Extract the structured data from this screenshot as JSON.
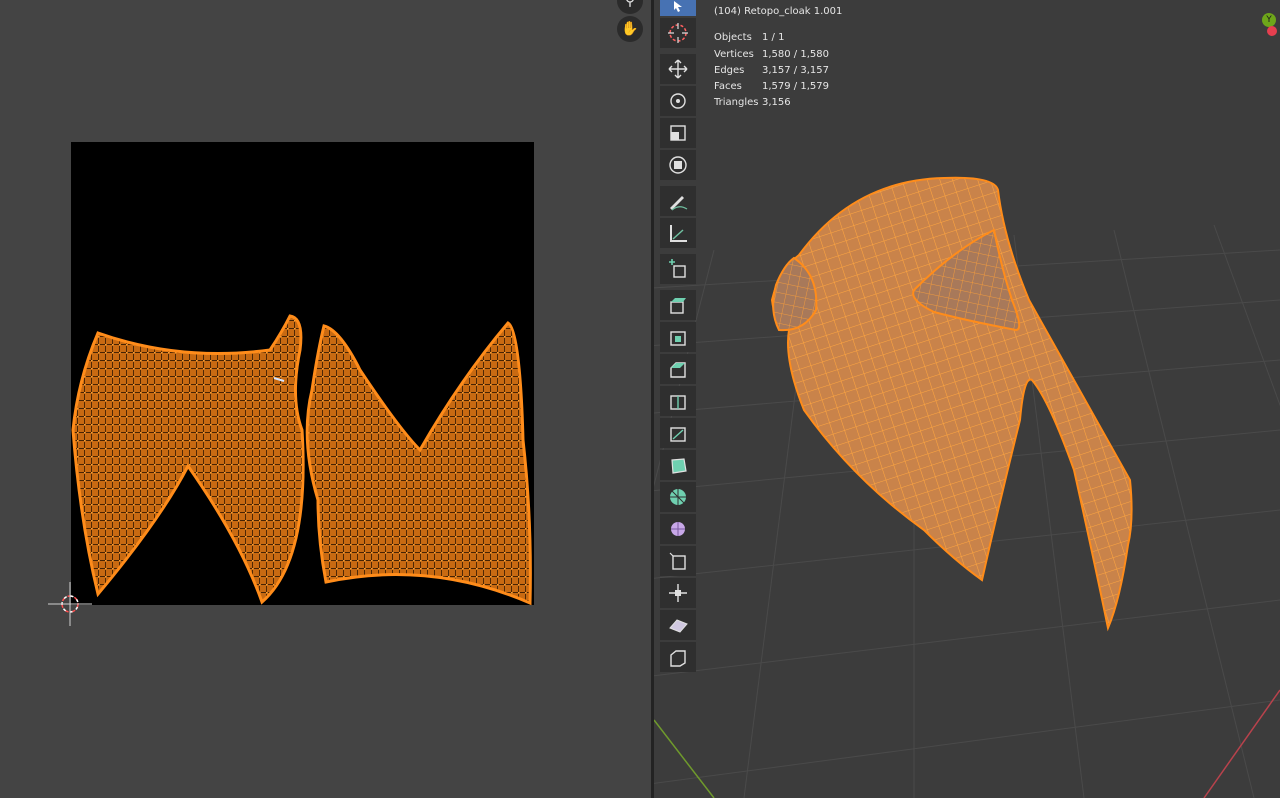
{
  "uv_editor": {
    "gizmo": {
      "zoom_icon": "magnifier-icon",
      "pan_icon": "hand-icon"
    },
    "accent_color": "#ff8c1a"
  },
  "viewport": {
    "object_name": "(104) Retopo_cloak 1.001",
    "stats": [
      {
        "label": "Objects",
        "value": "1 / 1"
      },
      {
        "label": "Vertices",
        "value": "1,580 / 1,580"
      },
      {
        "label": "Edges",
        "value": "3,157 / 3,157"
      },
      {
        "label": "Faces",
        "value": "1,579 / 1,579"
      },
      {
        "label": "Triangles",
        "value": "3,156"
      }
    ],
    "axis_gizmo": {
      "y_label": "Y",
      "y_color": "#6ea61a",
      "x_color": "#e63f4f"
    },
    "mesh_color": "#ff8c1a"
  },
  "toolbar": {
    "tools": [
      {
        "name": "select-box",
        "icon": "cursor-icon",
        "active": true
      },
      {
        "name": "cursor",
        "icon": "crosshair-icon",
        "active": false
      },
      {
        "name": "move",
        "icon": "move-icon",
        "active": false
      },
      {
        "name": "rotate",
        "icon": "rotate-icon",
        "active": false
      },
      {
        "name": "scale",
        "icon": "scale-icon",
        "active": false
      },
      {
        "name": "transform",
        "icon": "transform-icon",
        "active": false
      },
      {
        "name": "annotate",
        "icon": "pencil-icon",
        "active": false
      },
      {
        "name": "measure",
        "icon": "ruler-icon",
        "active": false
      },
      {
        "name": "add-cube",
        "icon": "add-cube-icon",
        "active": false
      },
      {
        "name": "extrude",
        "icon": "extrude-icon",
        "active": false
      },
      {
        "name": "inset",
        "icon": "inset-icon",
        "active": false
      },
      {
        "name": "bevel",
        "icon": "bevel-icon",
        "active": false
      },
      {
        "name": "loop-cut",
        "icon": "loop-cut-icon",
        "active": false
      },
      {
        "name": "knife",
        "icon": "knife-icon",
        "active": false
      },
      {
        "name": "poly-build",
        "icon": "poly-build-icon",
        "active": false
      },
      {
        "name": "spin",
        "icon": "spin-icon",
        "active": false
      },
      {
        "name": "smooth",
        "icon": "smooth-icon",
        "active": false
      },
      {
        "name": "edge-slide",
        "icon": "edge-slide-icon",
        "active": false
      },
      {
        "name": "shrink-fatten",
        "icon": "shrink-fatten-icon",
        "active": false
      },
      {
        "name": "shear",
        "icon": "shear-icon",
        "active": false
      },
      {
        "name": "rip",
        "icon": "rip-icon",
        "active": false
      }
    ]
  }
}
